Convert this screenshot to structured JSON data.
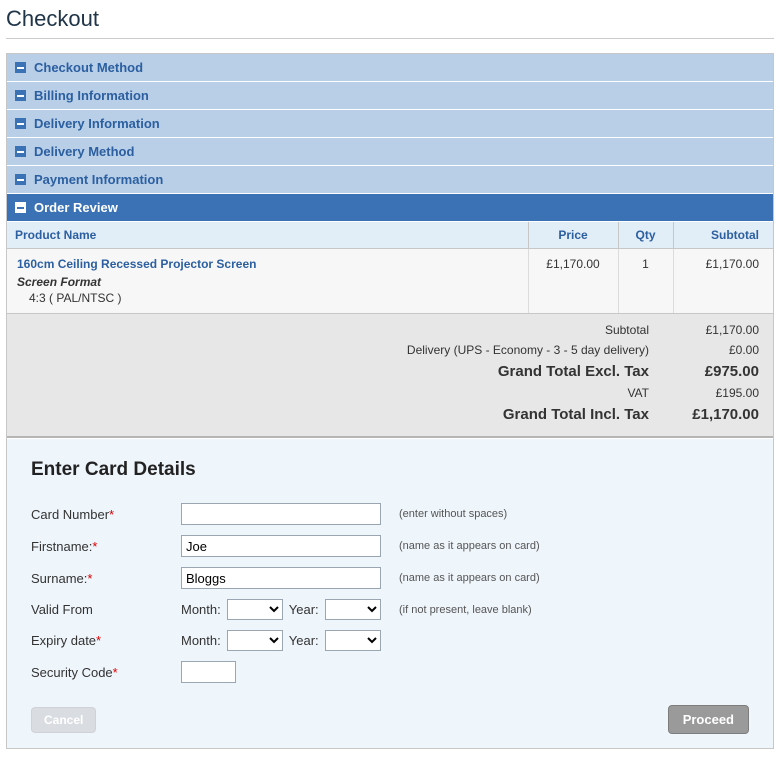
{
  "page": {
    "title": "Checkout"
  },
  "steps": [
    {
      "label": "Checkout Method"
    },
    {
      "label": "Billing Information"
    },
    {
      "label": "Delivery Information"
    },
    {
      "label": "Delivery Method"
    },
    {
      "label": "Payment Information"
    },
    {
      "label": "Order Review"
    }
  ],
  "order": {
    "headers": {
      "product": "Product Name",
      "price": "Price",
      "qty": "Qty",
      "subtotal": "Subtotal"
    },
    "item": {
      "name": "160cm Ceiling Recessed Projector Screen",
      "option_label": "Screen Format",
      "option_value": "4:3 ( PAL/NTSC )",
      "price": "£1,170.00",
      "qty": "1",
      "subtotal": "£1,170.00"
    },
    "totals": {
      "subtotal_label": "Subtotal",
      "subtotal_value": "£1,170.00",
      "delivery_label": "Delivery (UPS - Economy - 3 - 5 day delivery)",
      "delivery_value": "£0.00",
      "grand_excl_label": "Grand Total Excl. Tax",
      "grand_excl_value": "£975.00",
      "vat_label": "VAT",
      "vat_value": "£195.00",
      "grand_incl_label": "Grand Total Incl. Tax",
      "grand_incl_value": "£1,170.00"
    }
  },
  "card": {
    "title": "Enter Card Details",
    "number_label": "Card Number",
    "number_hint": "(enter without spaces)",
    "firstname_label": "Firstname:",
    "firstname_value": "Joe",
    "firstname_hint": "(name as it appears on card)",
    "surname_label": "Surname:",
    "surname_value": "Bloggs",
    "surname_hint": "(name as it appears on card)",
    "validfrom_label": "Valid From",
    "validfrom_hint": "(if not present, leave blank)",
    "expiry_label": "Expiry date",
    "security_label": "Security Code",
    "month_label": "Month:",
    "year_label": "Year:",
    "cancel": "Cancel",
    "proceed": "Proceed"
  }
}
